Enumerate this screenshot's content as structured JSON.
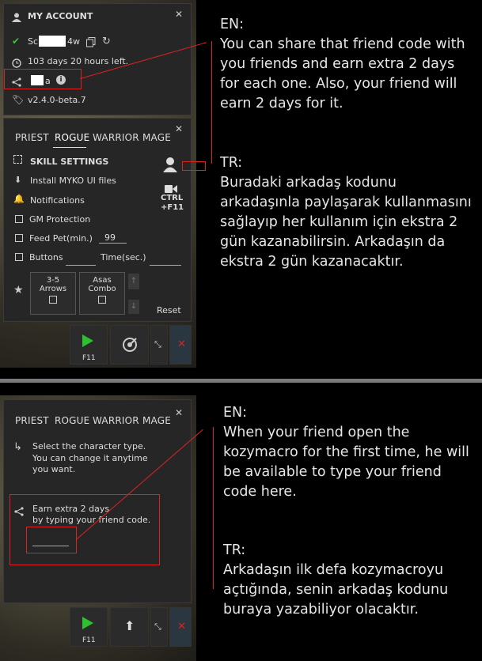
{
  "top": {
    "account": {
      "header": "MY ACCOUNT",
      "code_start": "Sc",
      "code_end": "4w",
      "time_left": "103 days 20 hours left.",
      "friend_code_end": "a",
      "version": "v2.4.0-beta.7"
    },
    "tabs": [
      "PRIEST",
      "ROGUE",
      "WARRIOR",
      "MAGE"
    ],
    "active_tab": "ROGUE",
    "menu": {
      "skill_settings": "SKILL SETTINGS",
      "install": "Install MYKO UI files",
      "notifications": "Notifications",
      "gm_protection": "GM Protection",
      "feed_pet": "Feed Pet(min.)",
      "feed_pet_value": "99",
      "buttons": "Buttons",
      "time": "Time(sec.)",
      "ctrl": "CTRL",
      "f11": "+F11",
      "arrows_line1": "3-5",
      "arrows_line2": "Arrows",
      "combo_line1": "Asas",
      "combo_line2": "Combo",
      "reset": "Reset"
    },
    "toolbar": {
      "f11": "F11"
    },
    "annotation": {
      "en_label": "EN:",
      "en_text": "You can share that friend code with you friends and earn extra 2 days for each one. Also, your friend will earn 2 days for it.",
      "tr_label": "TR:",
      "tr_text": "Buradaki arkadaş kodunu arkadaşınla paylaşarak kullanmasını sağlayıp her kullanım için ekstra 2 gün kazanabilirsin. Arkadaşın da ekstra 2 gün kazanacaktır."
    }
  },
  "bottom": {
    "tabs": [
      "PRIEST",
      "ROGUE",
      "WARRIOR",
      "MAGE"
    ],
    "select_line1": "Select the character type.",
    "select_line2": "You can change it anytime",
    "select_line3": "you want.",
    "earn_line1": "Earn extra 2 days",
    "earn_line2": "by typing your friend code.",
    "toolbar": {
      "f11": "F11"
    },
    "annotation": {
      "en_label": "EN:",
      "en_text": "When your friend open the kozymacro for the first time, he will be available to type your friend code here.",
      "tr_label": "TR:",
      "tr_text": "Arkadaşın ilk defa kozymacroyu açtığında, senin arkadaş kodunu buraya yazabiliyor olacaktır."
    }
  },
  "colors": {
    "accent_green": "#3cc13c",
    "highlight_red": "#dd2222",
    "panel_bg": "#262626"
  }
}
